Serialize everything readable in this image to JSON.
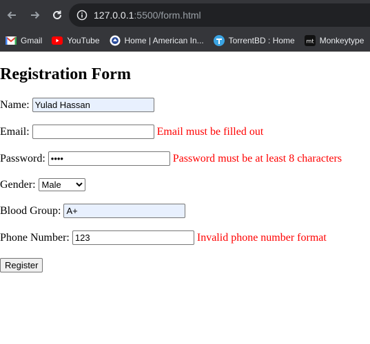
{
  "browser": {
    "url_host": "127.0.0.1",
    "url_rest": ":5500/form.html",
    "bookmarks": [
      {
        "label": "Gmail",
        "icon": "gmail-icon"
      },
      {
        "label": "YouTube",
        "icon": "youtube-icon"
      },
      {
        "label": "Home | American In...",
        "icon": "american-icon"
      },
      {
        "label": "TorrentBD : Home",
        "icon": "torrentbd-icon"
      },
      {
        "label": "Monkeytype",
        "icon": "monkeytype-icon"
      }
    ]
  },
  "form": {
    "title": "Registration Form",
    "name": {
      "label": "Name:",
      "value": "Yulad Hassan"
    },
    "email": {
      "label": "Email:",
      "value": "",
      "error": "Email must be filled out"
    },
    "password": {
      "label": "Password:",
      "value": "••••",
      "error": "Password must be at least 8 characters"
    },
    "gender": {
      "label": "Gender:",
      "selected": "Male"
    },
    "blood_group": {
      "label": "Blood Group:",
      "value": "A+"
    },
    "phone": {
      "label": "Phone Number:",
      "value": "123",
      "error": "Invalid phone number format"
    },
    "submit_label": "Register"
  },
  "colors": {
    "error": "#ff0000",
    "autofill": "#e8f0fe"
  }
}
